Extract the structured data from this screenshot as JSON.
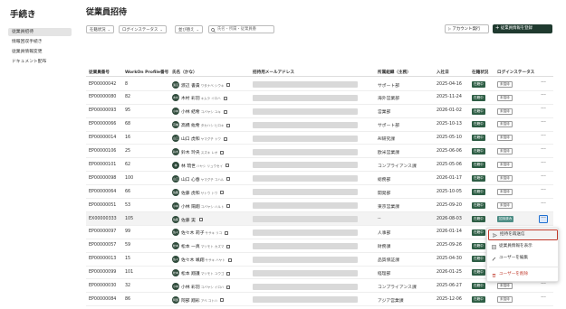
{
  "sidebar": {
    "title": "手続き",
    "items": [
      {
        "label": "従業員招待"
      },
      {
        "label": "情報回収手続き"
      },
      {
        "label": "従業員情報変更"
      },
      {
        "label": "ドキュメント配布"
      }
    ]
  },
  "page": {
    "title": "従業員招待"
  },
  "filters": {
    "status": "在籍状況",
    "login": "ログインステータス",
    "sort": "並び替え"
  },
  "search": {
    "placeholder": "氏名・所属・従業員番"
  },
  "actions": {
    "resend_label": "アカウント発行",
    "register_label": "従業員情報を登録"
  },
  "table": {
    "headers": {
      "emp_no": "従業員番号",
      "workon_no": "WorkOn Profile番号",
      "name": "氏名（かな）",
      "email": "招待用メールアドレス",
      "dept": "所属組織（主務）",
      "join_date": "入社日",
      "status": "在籍状況",
      "login": "ログインステータス"
    },
    "rows": [
      {
        "emp_no": "EP00000042",
        "workon_no": "8",
        "avatar": "渡辺",
        "name": "渡辺 書貴",
        "kana": "ワタナベ シウキ",
        "dept": "サポート部",
        "join_date": "2025-04-16",
        "status": "在籍中",
        "login": "未招待",
        "login_type": "outline"
      },
      {
        "emp_no": "EP00000080",
        "workon_no": "82",
        "avatar": "木村",
        "name": "木村 彩羽",
        "kana": "キムラ イロハ",
        "dept": "海外営業部",
        "join_date": "2025-11-24",
        "status": "在籍中",
        "login": "未招待",
        "login_type": "outline"
      },
      {
        "emp_no": "EP00000093",
        "workon_no": "95",
        "avatar": "小林",
        "name": "小林 結希",
        "kana": "コバヤシ ユキ",
        "dept": "営業部",
        "join_date": "2026-01-02",
        "status": "在籍中",
        "login": "未招待",
        "login_type": "outline"
      },
      {
        "emp_no": "EP00000066",
        "workon_no": "68",
        "avatar": "高橋",
        "name": "高橋 紘希",
        "kana": "タカハシ ヒロキ",
        "dept": "サポート部",
        "join_date": "2025-10-13",
        "status": "在籍中",
        "login": "未招待",
        "login_type": "outline"
      },
      {
        "emp_no": "EP00000014",
        "workon_no": "16",
        "avatar": "山口",
        "name": "山口 虎和",
        "kana": "ヤマグチ トワ",
        "dept": "AI研究課",
        "join_date": "2025-05-10",
        "status": "在籍中",
        "login": "未招待",
        "login_type": "outline"
      },
      {
        "emp_no": "EP00000106",
        "workon_no": "25",
        "avatar": "鈴木",
        "name": "鈴木 玲央",
        "kana": "スズキ レオ",
        "dept": "欧米営業課",
        "join_date": "2025-06-06",
        "status": "在籍中",
        "login": "未招待",
        "login_type": "outline"
      },
      {
        "emp_no": "EP00000101",
        "workon_no": "62",
        "avatar": "林",
        "name": "林 琉世",
        "kana": "ハヤシ リュウセイ",
        "dept": "コンプライアンス課",
        "join_date": "2025-05-06",
        "status": "在籍中",
        "login": "未招待",
        "login_type": "outline"
      },
      {
        "emp_no": "EP00000098",
        "workon_no": "100",
        "avatar": "山口",
        "name": "山口 心春",
        "kana": "ヤマグチ コハル",
        "dept": "総務部",
        "join_date": "2026-01-17",
        "status": "在籍中",
        "login": "未招待",
        "login_type": "outline"
      },
      {
        "emp_no": "EP00000064",
        "workon_no": "66",
        "avatar": "佐藤",
        "name": "佐藤 虎和",
        "kana": "サトウ トワ",
        "dept": "開発部",
        "join_date": "2025-10-05",
        "status": "在籍中",
        "login": "未招待",
        "login_type": "outline"
      },
      {
        "emp_no": "EP00000051",
        "workon_no": "53",
        "avatar": "小林",
        "name": "小林 陽翔",
        "kana": "コバヤシ ハルト",
        "dept": "東京営業課",
        "join_date": "2025-09-20",
        "status": "在籍中",
        "login": "未招待",
        "login_type": "outline"
      },
      {
        "emp_no": "EX00000333",
        "workon_no": "105",
        "avatar": "佐藤",
        "name": "佐藤 実",
        "kana": "",
        "dept": "--",
        "join_date": "2026-08-03",
        "status": "在籍中",
        "login": "招待済み",
        "login_type": "teal"
      },
      {
        "emp_no": "EP00000097",
        "workon_no": "99",
        "avatar": "佐々木",
        "name": "佐々木 莉子",
        "kana": "ササキ リコ",
        "dept": "人事部",
        "join_date": "2026-01-14",
        "status": "在籍中",
        "login": "未招待",
        "login_type": "outline"
      },
      {
        "emp_no": "EP00000057",
        "workon_no": "59",
        "avatar": "松本",
        "name": "松本 一真",
        "kana": "マツモト カズマ",
        "dept": "財務課",
        "join_date": "2025-09-26",
        "status": "在籍中",
        "login": "未招待",
        "login_type": "outline"
      },
      {
        "emp_no": "EP00000013",
        "workon_no": "15",
        "avatar": "佐々木",
        "name": "佐々木 颯翔",
        "kana": "ササキ ハヤト",
        "dept": "品質保証課",
        "join_date": "2025-04-30",
        "status": "在籍中",
        "login": "未招待",
        "login_type": "outline"
      },
      {
        "emp_no": "EP00000099",
        "workon_no": "101",
        "avatar": "松本",
        "name": "松本 翔護",
        "kana": "マツモト ユウゴ",
        "dept": "経理部",
        "join_date": "2026-01-25",
        "status": "在籍中",
        "login": "未招待",
        "login_type": "outline"
      },
      {
        "emp_no": "EP00000030",
        "workon_no": "32",
        "avatar": "小林",
        "name": "小林 彩羽",
        "kana": "コバヤシ イロハ",
        "dept": "コンプライアンス課",
        "join_date": "2025-06-27",
        "status": "在籍中",
        "login": "未招待",
        "login_type": "outline"
      },
      {
        "emp_no": "EP00000084",
        "workon_no": "86",
        "avatar": "阿部",
        "name": "阿部 翔彩",
        "kana": "アベ コトハ",
        "dept": "アジア営業課",
        "join_date": "2025-12-06",
        "status": "在籍中",
        "login": "未招待",
        "login_type": "outline"
      }
    ]
  },
  "menu": {
    "items": [
      {
        "label": "招待を再送信",
        "icon": "send-icon"
      },
      {
        "label": "従業員情報を表示",
        "icon": "list-icon"
      },
      {
        "label": "ユーザーを編集",
        "icon": "pencil-icon"
      },
      {
        "label": "ユーザーを削除",
        "icon": "trash-icon"
      }
    ]
  },
  "colors": {
    "primary": "#1f3a2f",
    "status_green": "#2e5e45",
    "invited_teal": "#4e8e86",
    "danger": "#c0392b",
    "focus_blue": "#1f6fd0"
  }
}
